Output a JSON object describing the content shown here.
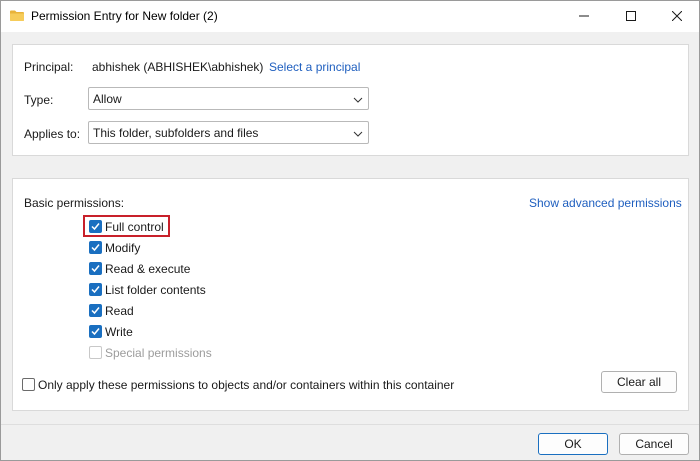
{
  "window": {
    "title": "Permission Entry for New folder (2)"
  },
  "principal": {
    "label": "Principal:",
    "value": "abhishek (ABHISHEK\\abhishek)",
    "select_link": "Select a principal"
  },
  "type": {
    "label": "Type:",
    "selected": "Allow"
  },
  "applies_to": {
    "label": "Applies to:",
    "selected": "This folder, subfolders and files"
  },
  "permissions": {
    "header": "Basic permissions:",
    "advanced_link": "Show advanced permissions",
    "items": [
      {
        "label": "Full control",
        "checked": true,
        "enabled": true
      },
      {
        "label": "Modify",
        "checked": true,
        "enabled": true
      },
      {
        "label": "Read & execute",
        "checked": true,
        "enabled": true
      },
      {
        "label": "List folder contents",
        "checked": true,
        "enabled": true
      },
      {
        "label": "Read",
        "checked": true,
        "enabled": true
      },
      {
        "label": "Write",
        "checked": true,
        "enabled": true
      },
      {
        "label": "Special permissions",
        "checked": false,
        "enabled": false
      }
    ],
    "only_apply_label": "Only apply these permissions to objects and/or containers within this container",
    "only_apply_checked": false,
    "clear_all_label": "Clear all"
  },
  "footer": {
    "ok_label": "OK",
    "cancel_label": "Cancel"
  },
  "colors": {
    "accent": "#1a6fc0",
    "link": "#1f5fbf",
    "highlight": "#c8202a"
  },
  "icons": {
    "title": "folder-icon",
    "minimize": "minimize-icon",
    "maximize": "maximize-icon",
    "close": "close-icon",
    "dropdown": "chevron-down-icon",
    "check": "checkmark-icon"
  }
}
